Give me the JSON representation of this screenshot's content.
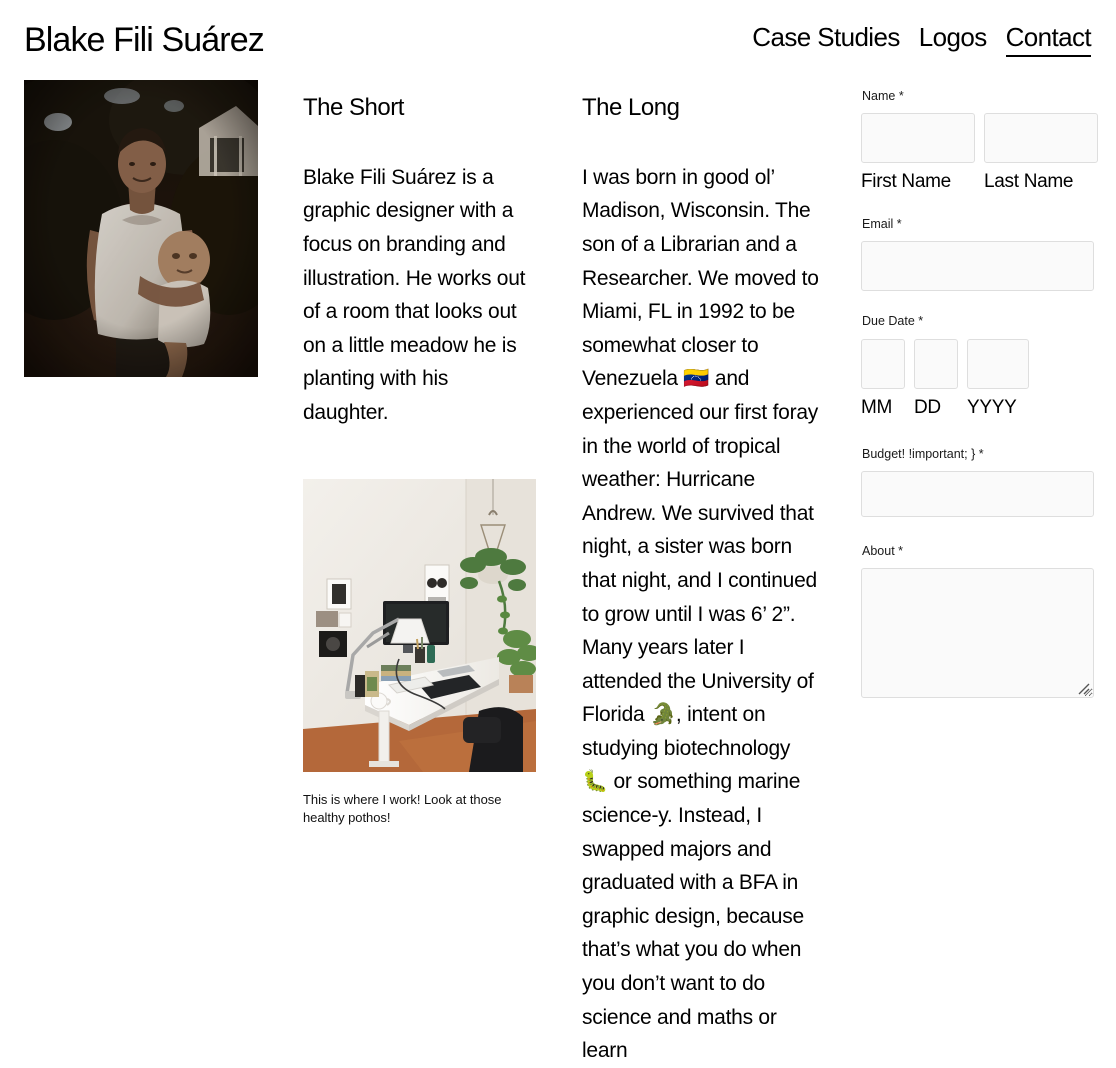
{
  "header": {
    "site_title": "Blake Fili Suárez",
    "nav": [
      {
        "label": "Case Studies",
        "active": false
      },
      {
        "label": "Logos",
        "active": false
      },
      {
        "label": "Contact",
        "active": true
      }
    ]
  },
  "photos": {
    "portrait_alt": "Blake holding his infant daughter outdoors at dusk",
    "desk_alt": "A white standing desk with monitor, lamp and hanging pothos plant",
    "caption": "This is where I work! Look at those healthy pothos!"
  },
  "short": {
    "heading": "The Short",
    "body": "Blake Fili Suárez is a graphic designer with a focus on branding and illustration. He works out of a room that looks out on a little meadow he is planting with his daughter."
  },
  "long": {
    "heading": "The Long",
    "body": "I was born in good ol’ Madison, Wisconsin. The son of a Librarian and a Researcher. We moved to Miami, FL in 1992 to be somewhat closer to Venezuela 🇻🇪 and experienced our first foray in the world of tropical weather: Hurricane Andrew. We survived that night, a sister was born that night, and I continued to grow until I was 6’ 2”. Many years later I attended the University of Florida 🐊, intent on studying biotechnology 🐛 or something marine science-y. Instead, I swapped majors and graduated with a BFA in graphic design, because that’s what you do when you don’t want to do science and maths or learn"
  },
  "form": {
    "name": {
      "label": "Name *",
      "first_value": "",
      "first_sub_label": "First Name",
      "last_value": "",
      "last_sub_label": "Last Name"
    },
    "email": {
      "label": "Email *",
      "value": ""
    },
    "due_date": {
      "label": "Due Date *",
      "mm_value": "",
      "mm_sub_label": "MM",
      "dd_value": "",
      "dd_sub_label": "DD",
      "yyyy_value": "",
      "yyyy_sub_label": "YYYY"
    },
    "budget": {
      "label": "Budget! !important; } *",
      "value": ""
    },
    "about": {
      "label": "About *",
      "value": ""
    }
  },
  "colors": {
    "page_background": "#ffffff",
    "text": "#111111",
    "input_background": "#fafafa",
    "input_border": "#dedede",
    "accent_underline": "#000000"
  }
}
